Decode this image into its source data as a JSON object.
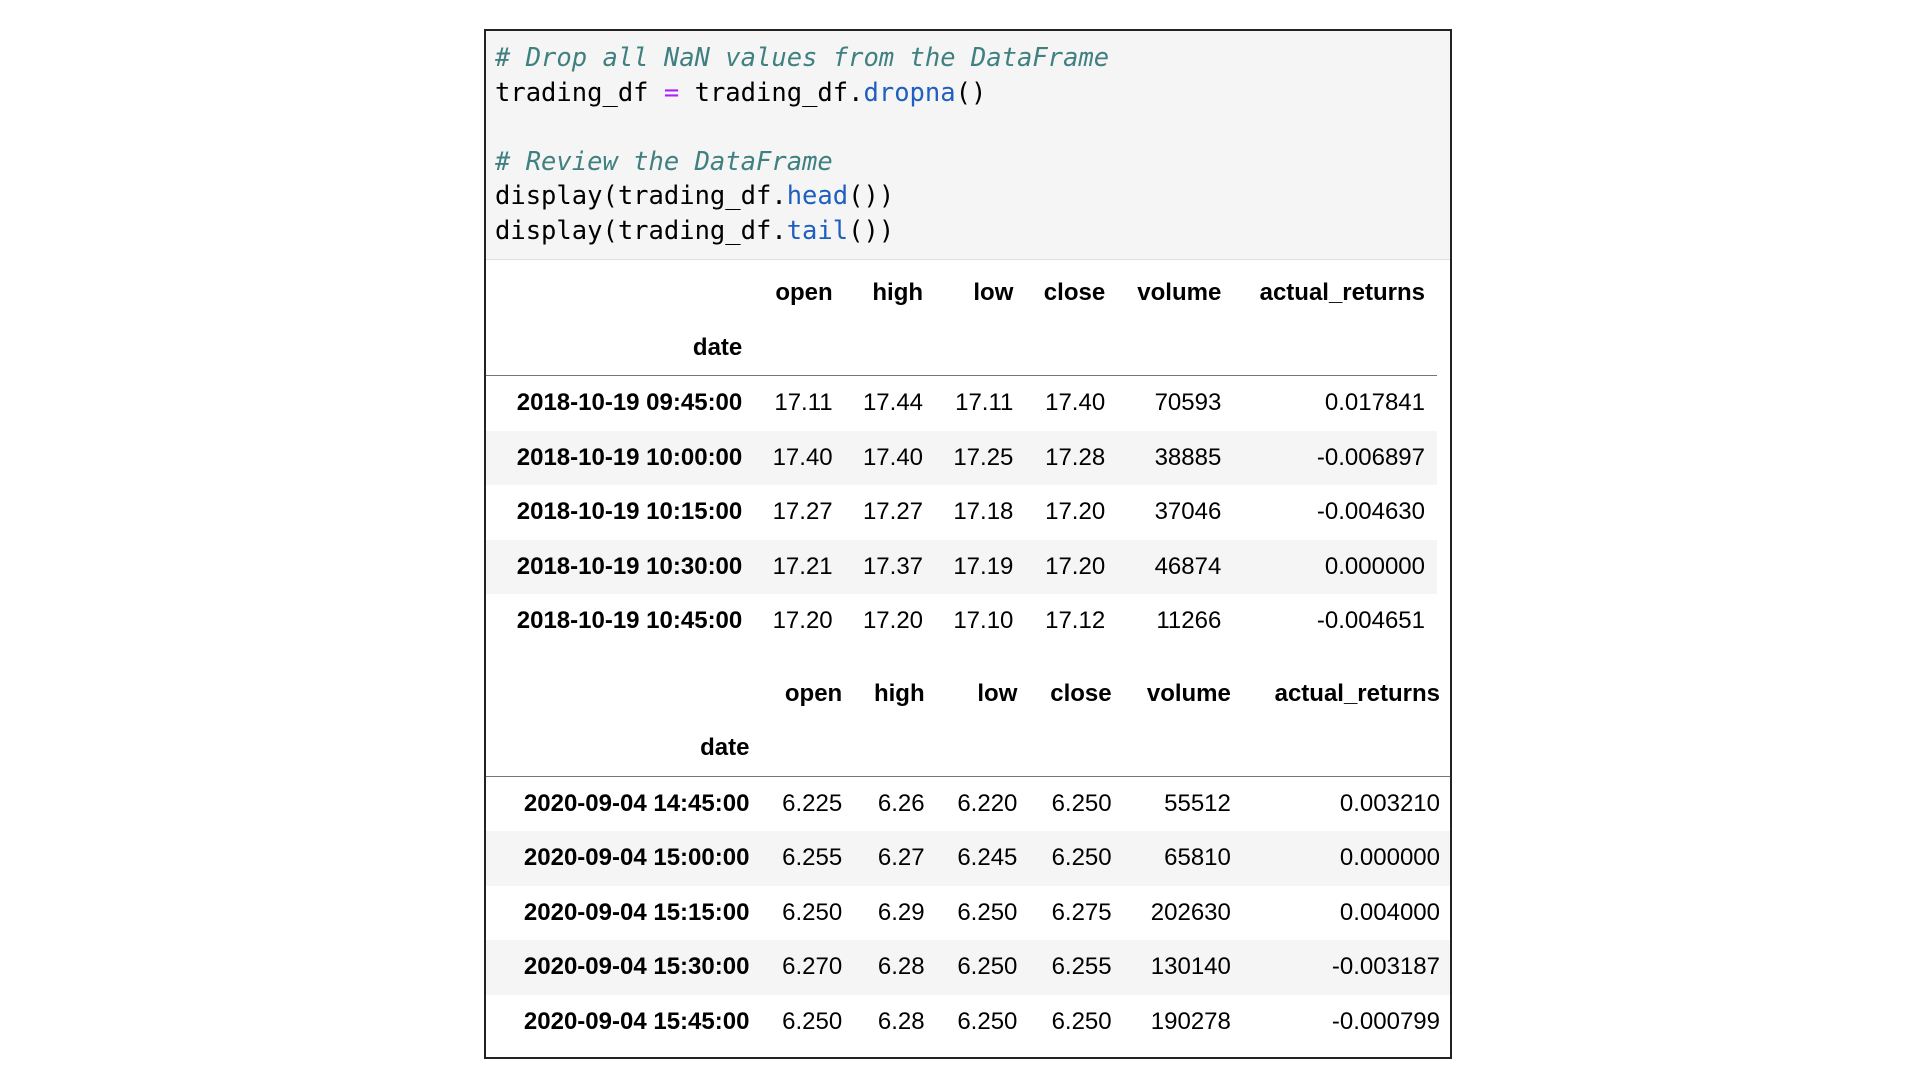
{
  "code": {
    "lines": [
      {
        "parts": [
          {
            "t": "# Drop all NaN values from the DataFrame",
            "c": "cm"
          }
        ]
      },
      {
        "parts": [
          {
            "t": "trading_df ",
            "c": ""
          },
          {
            "t": "=",
            "c": "op"
          },
          {
            "t": " trading_df.",
            "c": ""
          },
          {
            "t": "dropna",
            "c": "fn"
          },
          {
            "t": "()",
            "c": ""
          }
        ]
      },
      {
        "parts": [
          {
            "t": "",
            "c": ""
          }
        ]
      },
      {
        "parts": [
          {
            "t": "# Review the DataFrame",
            "c": "cm"
          }
        ]
      },
      {
        "parts": [
          {
            "t": "display(trading_df.",
            "c": ""
          },
          {
            "t": "head",
            "c": "fn"
          },
          {
            "t": "())",
            "c": ""
          }
        ]
      },
      {
        "parts": [
          {
            "t": "display(trading_df.",
            "c": ""
          },
          {
            "t": "tail",
            "c": "fn"
          },
          {
            "t": "())",
            "c": ""
          }
        ]
      }
    ]
  },
  "tables": [
    {
      "columns": [
        "open",
        "high",
        "low",
        "close",
        "volume",
        "actual_returns"
      ],
      "index_name": "date",
      "rows": [
        {
          "index": "2018-10-19 09:45:00",
          "values": [
            "17.11",
            "17.44",
            "17.11",
            "17.40",
            "70593",
            "0.017841"
          ]
        },
        {
          "index": "2018-10-19 10:00:00",
          "values": [
            "17.40",
            "17.40",
            "17.25",
            "17.28",
            "38885",
            "-0.006897"
          ]
        },
        {
          "index": "2018-10-19 10:15:00",
          "values": [
            "17.27",
            "17.27",
            "17.18",
            "17.20",
            "37046",
            "-0.004630"
          ]
        },
        {
          "index": "2018-10-19 10:30:00",
          "values": [
            "17.21",
            "17.37",
            "17.19",
            "17.20",
            "46874",
            "0.000000"
          ]
        },
        {
          "index": "2018-10-19 10:45:00",
          "values": [
            "17.20",
            "17.20",
            "17.10",
            "17.12",
            "11266",
            "-0.004651"
          ]
        }
      ]
    },
    {
      "columns": [
        "open",
        "high",
        "low",
        "close",
        "volume",
        "actual_returns"
      ],
      "index_name": "date",
      "rows": [
        {
          "index": "2020-09-04 14:45:00",
          "values": [
            "6.225",
            "6.26",
            "6.220",
            "6.250",
            "55512",
            "0.003210"
          ]
        },
        {
          "index": "2020-09-04 15:00:00",
          "values": [
            "6.255",
            "6.27",
            "6.245",
            "6.250",
            "65810",
            "0.000000"
          ]
        },
        {
          "index": "2020-09-04 15:15:00",
          "values": [
            "6.250",
            "6.29",
            "6.250",
            "6.275",
            "202630",
            "0.004000"
          ]
        },
        {
          "index": "2020-09-04 15:30:00",
          "values": [
            "6.270",
            "6.28",
            "6.250",
            "6.255",
            "130140",
            "-0.003187"
          ]
        },
        {
          "index": "2020-09-04 15:45:00",
          "values": [
            "6.250",
            "6.28",
            "6.250",
            "6.250",
            "190278",
            "-0.000799"
          ]
        }
      ]
    }
  ]
}
